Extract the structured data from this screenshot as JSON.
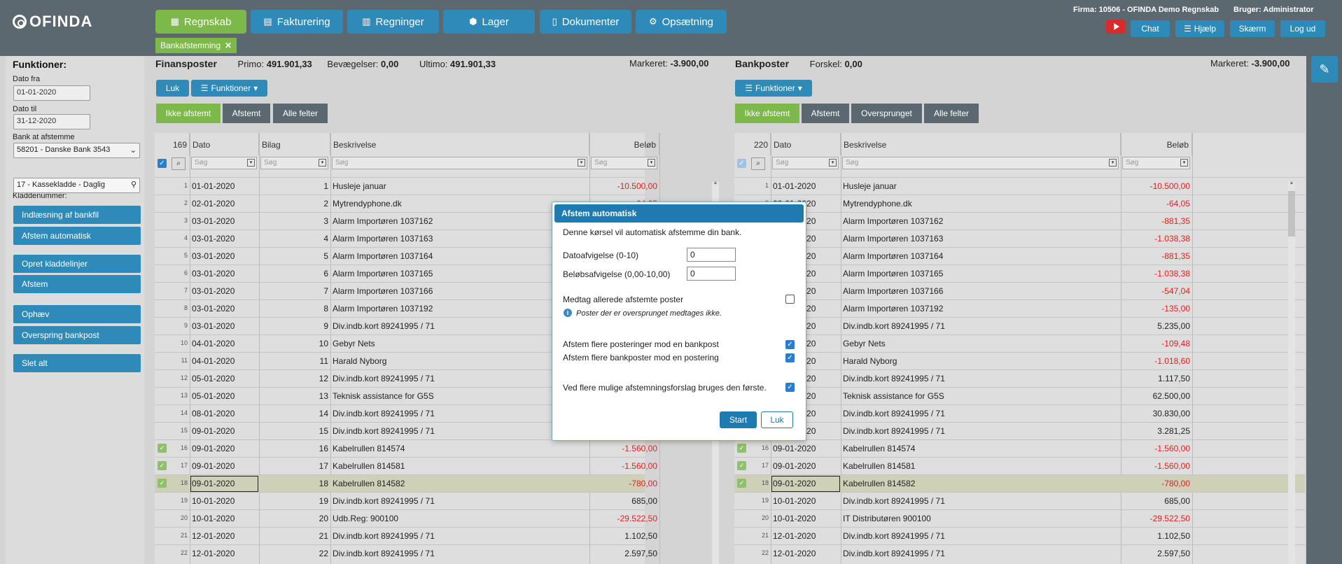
{
  "app": {
    "logo_text": "OFINDA"
  },
  "nav": [
    {
      "label": "Regnskab",
      "icon": "calculator-icon",
      "glyph": "▦",
      "active": true
    },
    {
      "label": "Fakturering",
      "icon": "clipboard-icon",
      "glyph": "▤",
      "active": false
    },
    {
      "label": "Regninger",
      "icon": "bar-chart-icon",
      "glyph": "▥",
      "active": false
    },
    {
      "label": "Lager",
      "icon": "boxes-icon",
      "glyph": "⬢",
      "active": false
    },
    {
      "label": "Dokumenter",
      "icon": "file-icon",
      "glyph": "▯",
      "active": false
    },
    {
      "label": "Opsætning",
      "icon": "gear-icon",
      "glyph": "⚙",
      "active": false
    }
  ],
  "firm_label": "Firma: 10506 - OFINDA Demo Regnskab",
  "user_label": "Bruger: Administrator",
  "top_actions": {
    "chat": "Chat",
    "help": "Hjælp",
    "screen": "Skærm",
    "logout": "Log ud"
  },
  "open_tab": {
    "label": "Bankafstemning",
    "close": "✕"
  },
  "sidebar": {
    "title": "Funktioner:",
    "date_from_label": "Dato fra",
    "date_from": "01-01-2020",
    "date_to_label": "Dato til",
    "date_to": "31-12-2020",
    "bank_label": "Bank at afstemme",
    "bank_value": "58201 - Danske Bank 3543",
    "journal_label": "Kladdenummer:",
    "journal_value": "17 - Kassekladde - Daglig",
    "buttons": [
      "Indlæsning af bankfil",
      "Afstem automatisk",
      "Opret kladdelinjer",
      "Afstem",
      "Ophæv",
      "Overspring bankpost",
      "Slet alt"
    ]
  },
  "left": {
    "title": "Finansposter",
    "primo_label": "Primo:",
    "primo": "491.901,33",
    "bev_label": "Bevægelser:",
    "bev": "0,00",
    "ultimo_label": "Ultimo:",
    "ultimo": "491.901,33",
    "marked_label": "Markeret:",
    "marked": "-3.900,00",
    "close_btn": "Luk",
    "func_btn": "Funktioner",
    "tabs": [
      "Ikke afstemt",
      "Afstemt",
      "Alle felter"
    ],
    "count": "169",
    "headers": {
      "date": "Dato",
      "voucher": "Bilag",
      "desc": "Beskrivelse",
      "amount": "Beløb"
    },
    "filter_placeholder": "Søg",
    "rows": [
      {
        "n": "1",
        "date": "01-01-2020",
        "bilag": "1",
        "desc": "Husleje januar",
        "amt": "-10.500,00",
        "neg": true,
        "ok": false
      },
      {
        "n": "2",
        "date": "02-01-2020",
        "bilag": "2",
        "desc": "Mytrendyphone.dk",
        "amt": "-64,05",
        "neg": true,
        "ok": false
      },
      {
        "n": "3",
        "date": "03-01-2020",
        "bilag": "3",
        "desc": "Alarm Importøren 1037162",
        "amt": "",
        "neg": true,
        "ok": false
      },
      {
        "n": "4",
        "date": "03-01-2020",
        "bilag": "4",
        "desc": "Alarm Importøren 1037163",
        "amt": "",
        "neg": true,
        "ok": false
      },
      {
        "n": "5",
        "date": "03-01-2020",
        "bilag": "5",
        "desc": "Alarm Importøren 1037164",
        "amt": "",
        "neg": true,
        "ok": false
      },
      {
        "n": "6",
        "date": "03-01-2020",
        "bilag": "6",
        "desc": "Alarm Importøren 1037165",
        "amt": "",
        "neg": true,
        "ok": false
      },
      {
        "n": "7",
        "date": "03-01-2020",
        "bilag": "7",
        "desc": "Alarm Importøren 1037166",
        "amt": "",
        "neg": true,
        "ok": false
      },
      {
        "n": "8",
        "date": "03-01-2020",
        "bilag": "8",
        "desc": "Alarm Importøren 1037192",
        "amt": "",
        "neg": true,
        "ok": false
      },
      {
        "n": "9",
        "date": "03-01-2020",
        "bilag": "9",
        "desc": "Div.indb.kort 89241995 / 71",
        "amt": "",
        "neg": false,
        "ok": false
      },
      {
        "n": "10",
        "date": "04-01-2020",
        "bilag": "10",
        "desc": "Gebyr Nets",
        "amt": "",
        "neg": true,
        "ok": false
      },
      {
        "n": "11",
        "date": "04-01-2020",
        "bilag": "11",
        "desc": "Harald Nyborg",
        "amt": "",
        "neg": true,
        "ok": false
      },
      {
        "n": "12",
        "date": "05-01-2020",
        "bilag": "12",
        "desc": "Div.indb.kort 89241995 / 71",
        "amt": "",
        "neg": false,
        "ok": false
      },
      {
        "n": "13",
        "date": "05-01-2020",
        "bilag": "13",
        "desc": "Teknisk assistance for G5S",
        "amt": "",
        "neg": false,
        "ok": false
      },
      {
        "n": "14",
        "date": "08-01-2020",
        "bilag": "14",
        "desc": "Div.indb.kort 89241995 / 71",
        "amt": "",
        "neg": false,
        "ok": false
      },
      {
        "n": "15",
        "date": "09-01-2020",
        "bilag": "15",
        "desc": "Div.indb.kort 89241995 / 71",
        "amt": "",
        "neg": false,
        "ok": false
      },
      {
        "n": "16",
        "date": "09-01-2020",
        "bilag": "16",
        "desc": "Kabelrullen 814574",
        "amt": "-1.560,00",
        "neg": true,
        "ok": true
      },
      {
        "n": "17",
        "date": "09-01-2020",
        "bilag": "17",
        "desc": "Kabelrullen 814581",
        "amt": "-1.560,00",
        "neg": true,
        "ok": true
      },
      {
        "n": "18",
        "date": "09-01-2020",
        "bilag": "18",
        "desc": "Kabelrullen 814582",
        "amt": "-780,00",
        "neg": true,
        "ok": true,
        "hl": true
      },
      {
        "n": "19",
        "date": "10-01-2020",
        "bilag": "19",
        "desc": "Div.indb.kort 89241995 / 71",
        "amt": "685,00",
        "neg": false,
        "ok": false
      },
      {
        "n": "20",
        "date": "10-01-2020",
        "bilag": "20",
        "desc": "Udb.Reg: 900100",
        "amt": "-29.522,50",
        "neg": true,
        "ok": false
      },
      {
        "n": "21",
        "date": "12-01-2020",
        "bilag": "21",
        "desc": "Div.indb.kort 89241995 / 71",
        "amt": "1.102,50",
        "neg": false,
        "ok": false
      },
      {
        "n": "22",
        "date": "12-01-2020",
        "bilag": "22",
        "desc": "Div.indb.kort 89241995 / 71",
        "amt": "2.597,50",
        "neg": false,
        "ok": false
      }
    ]
  },
  "right": {
    "title": "Bankposter",
    "diff_label": "Forskel:",
    "diff": "0,00",
    "marked_label": "Markeret:",
    "marked": "-3.900,00",
    "func_btn": "Funktioner",
    "tabs": [
      "Ikke afstemt",
      "Afstemt",
      "Oversprunget",
      "Alle felter"
    ],
    "count": "220",
    "headers": {
      "date": "Dato",
      "desc": "Beskrivelse",
      "amount": "Beløb"
    },
    "filter_placeholder": "Søg",
    "rows": [
      {
        "n": "1",
        "date": "01-01-2020",
        "desc": "Husleje januar",
        "amt": "-10.500,00",
        "neg": true,
        "ok": false
      },
      {
        "n": "2",
        "date": "02-01-2020",
        "desc": "Mytrendyphone.dk",
        "amt": "-64,05",
        "neg": true,
        "ok": false
      },
      {
        "n": "3",
        "date": "03-01-2020",
        "desc": "Alarm Importøren 1037162",
        "amt": "-881,35",
        "neg": true,
        "ok": false
      },
      {
        "n": "4",
        "date": "03-01-2020",
        "desc": "Alarm Importøren 1037163",
        "amt": "-1.038,38",
        "neg": true,
        "ok": false
      },
      {
        "n": "5",
        "date": "03-01-2020",
        "desc": "Alarm Importøren 1037164",
        "amt": "-881,35",
        "neg": true,
        "ok": false
      },
      {
        "n": "6",
        "date": "03-01-2020",
        "desc": "Alarm Importøren 1037165",
        "amt": "-1.038,38",
        "neg": true,
        "ok": false
      },
      {
        "n": "7",
        "date": "03-01-2020",
        "desc": "Alarm Importøren 1037166",
        "amt": "-547,04",
        "neg": true,
        "ok": false
      },
      {
        "n": "8",
        "date": "03-01-2020",
        "desc": "Alarm Importøren 1037192",
        "amt": "-135,00",
        "neg": true,
        "ok": false
      },
      {
        "n": "9",
        "date": "03-01-2020",
        "desc": "Div.indb.kort 89241995 / 71",
        "amt": "5.235,00",
        "neg": false,
        "ok": false
      },
      {
        "n": "10",
        "date": "04-01-2020",
        "desc": "Gebyr Nets",
        "amt": "-109,48",
        "neg": true,
        "ok": false
      },
      {
        "n": "11",
        "date": "04-01-2020",
        "desc": "Harald Nyborg",
        "amt": "-1.018,60",
        "neg": true,
        "ok": false
      },
      {
        "n": "12",
        "date": "05-01-2020",
        "desc": "Div.indb.kort 89241995 / 71",
        "amt": "1.117,50",
        "neg": false,
        "ok": false
      },
      {
        "n": "13",
        "date": "05-01-2020",
        "desc": "Teknisk assistance for G5S",
        "amt": "62.500,00",
        "neg": false,
        "ok": false
      },
      {
        "n": "14",
        "date": "08-01-2020",
        "desc": "Div.indb.kort 89241995 / 71",
        "amt": "30.830,00",
        "neg": false,
        "ok": false
      },
      {
        "n": "15",
        "date": "09-01-2020",
        "desc": "Div.indb.kort 89241995 / 71",
        "amt": "3.281,25",
        "neg": false,
        "ok": false
      },
      {
        "n": "16",
        "date": "09-01-2020",
        "desc": "Kabelrullen 814574",
        "amt": "-1.560,00",
        "neg": true,
        "ok": true
      },
      {
        "n": "17",
        "date": "09-01-2020",
        "desc": "Kabelrullen 814581",
        "amt": "-1.560,00",
        "neg": true,
        "ok": true
      },
      {
        "n": "18",
        "date": "09-01-2020",
        "desc": "Kabelrullen 814582",
        "amt": "-780,00",
        "neg": true,
        "ok": true,
        "hl": true
      },
      {
        "n": "19",
        "date": "10-01-2020",
        "desc": "Div.indb.kort 89241995 / 71",
        "amt": "685,00",
        "neg": false,
        "ok": false
      },
      {
        "n": "20",
        "date": "10-01-2020",
        "desc": "IT Distributøren 900100",
        "amt": "-29.522,50",
        "neg": true,
        "ok": false
      },
      {
        "n": "21",
        "date": "12-01-2020",
        "desc": "Div.indb.kort 89241995 / 71",
        "amt": "1.102,50",
        "neg": false,
        "ok": false
      },
      {
        "n": "22",
        "date": "12-01-2020",
        "desc": "Div.indb.kort 89241995 / 71",
        "amt": "2.597,50",
        "neg": false,
        "ok": false
      }
    ]
  },
  "dialog": {
    "title": "Afstem automatisk",
    "intro": "Denne kørsel vil automatisk afstemme din bank.",
    "date_dev_label": "Datoafvigelse (0-10)",
    "date_dev": "0",
    "amt_dev_label": "Beløbsafvigelse (0,00-10,00)",
    "amt_dev": "0",
    "include_label": "Medtag allerede afstemte poster",
    "info_text": "Poster der er oversprunget medtages ikke.",
    "multi_post_label": "Afstem flere posteringer mod en bankpost",
    "multi_bank_label": "Afstem flere bankposter mod en postering",
    "first_label": "Ved flere mulige afstemningsforslag bruges den første.",
    "start": "Start",
    "close": "Luk"
  }
}
